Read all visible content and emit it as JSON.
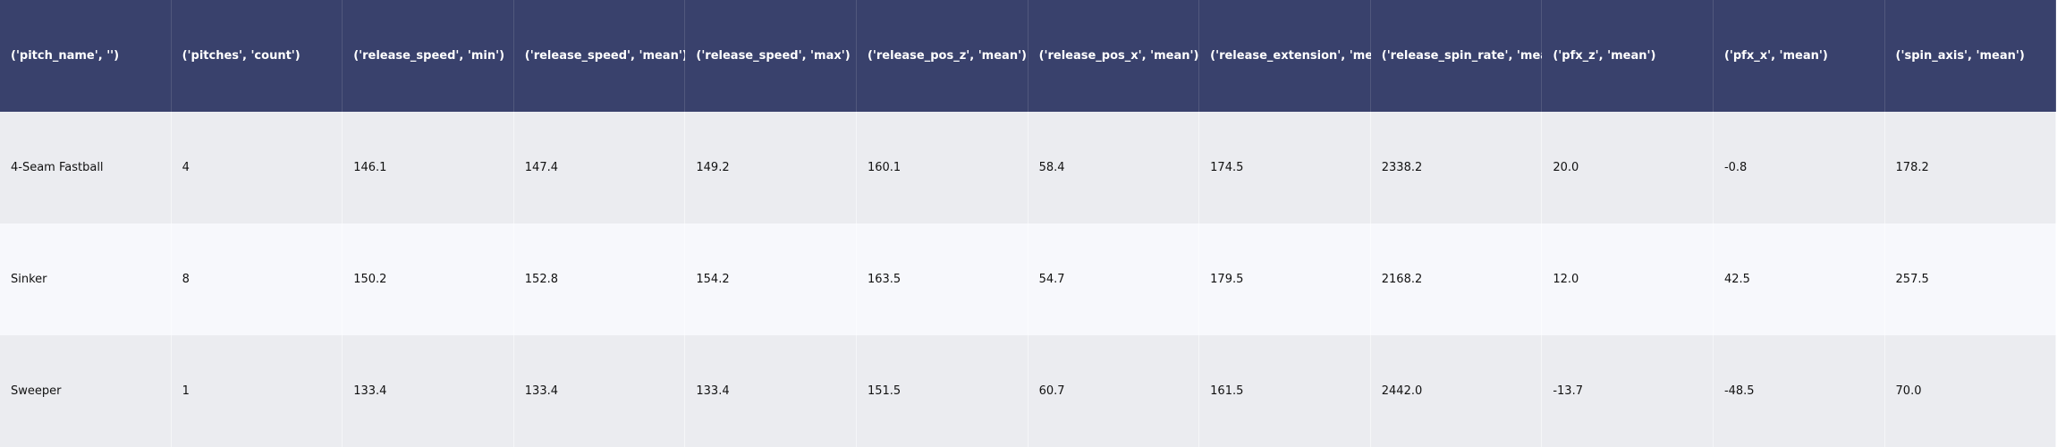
{
  "table": {
    "columns": [
      "('pitch_name', '')",
      "('pitches', 'count')",
      "('release_speed', 'min')",
      "('release_speed', 'mean')",
      "('release_speed', 'max')",
      "('release_pos_z', 'mean')",
      "('release_pos_x', 'mean')",
      "('release_extension', 'mean')",
      "('release_spin_rate', 'mean')",
      "('pfx_z', 'mean')",
      "('pfx_x', 'mean')",
      "('spin_axis', 'mean')"
    ],
    "rows": [
      [
        "4-Seam Fastball",
        "4",
        "146.1",
        "147.4",
        "149.2",
        "160.1",
        "58.4",
        "174.5",
        "2338.2",
        "20.0",
        "-0.8",
        "178.2"
      ],
      [
        "Sinker",
        "8",
        "150.2",
        "152.8",
        "154.2",
        "163.5",
        "54.7",
        "179.5",
        "2168.2",
        "12.0",
        "42.5",
        "257.5"
      ],
      [
        "Sweeper",
        "1",
        "133.4",
        "133.4",
        "133.4",
        "151.5",
        "60.7",
        "161.5",
        "2442.0",
        "-13.7",
        "-48.5",
        "70.0"
      ]
    ]
  },
  "colors": {
    "header_bg": "#39416c",
    "header_text": "#ffffff",
    "row_odd_bg": "#ebecf0",
    "row_even_bg": "#f7f8fc"
  }
}
